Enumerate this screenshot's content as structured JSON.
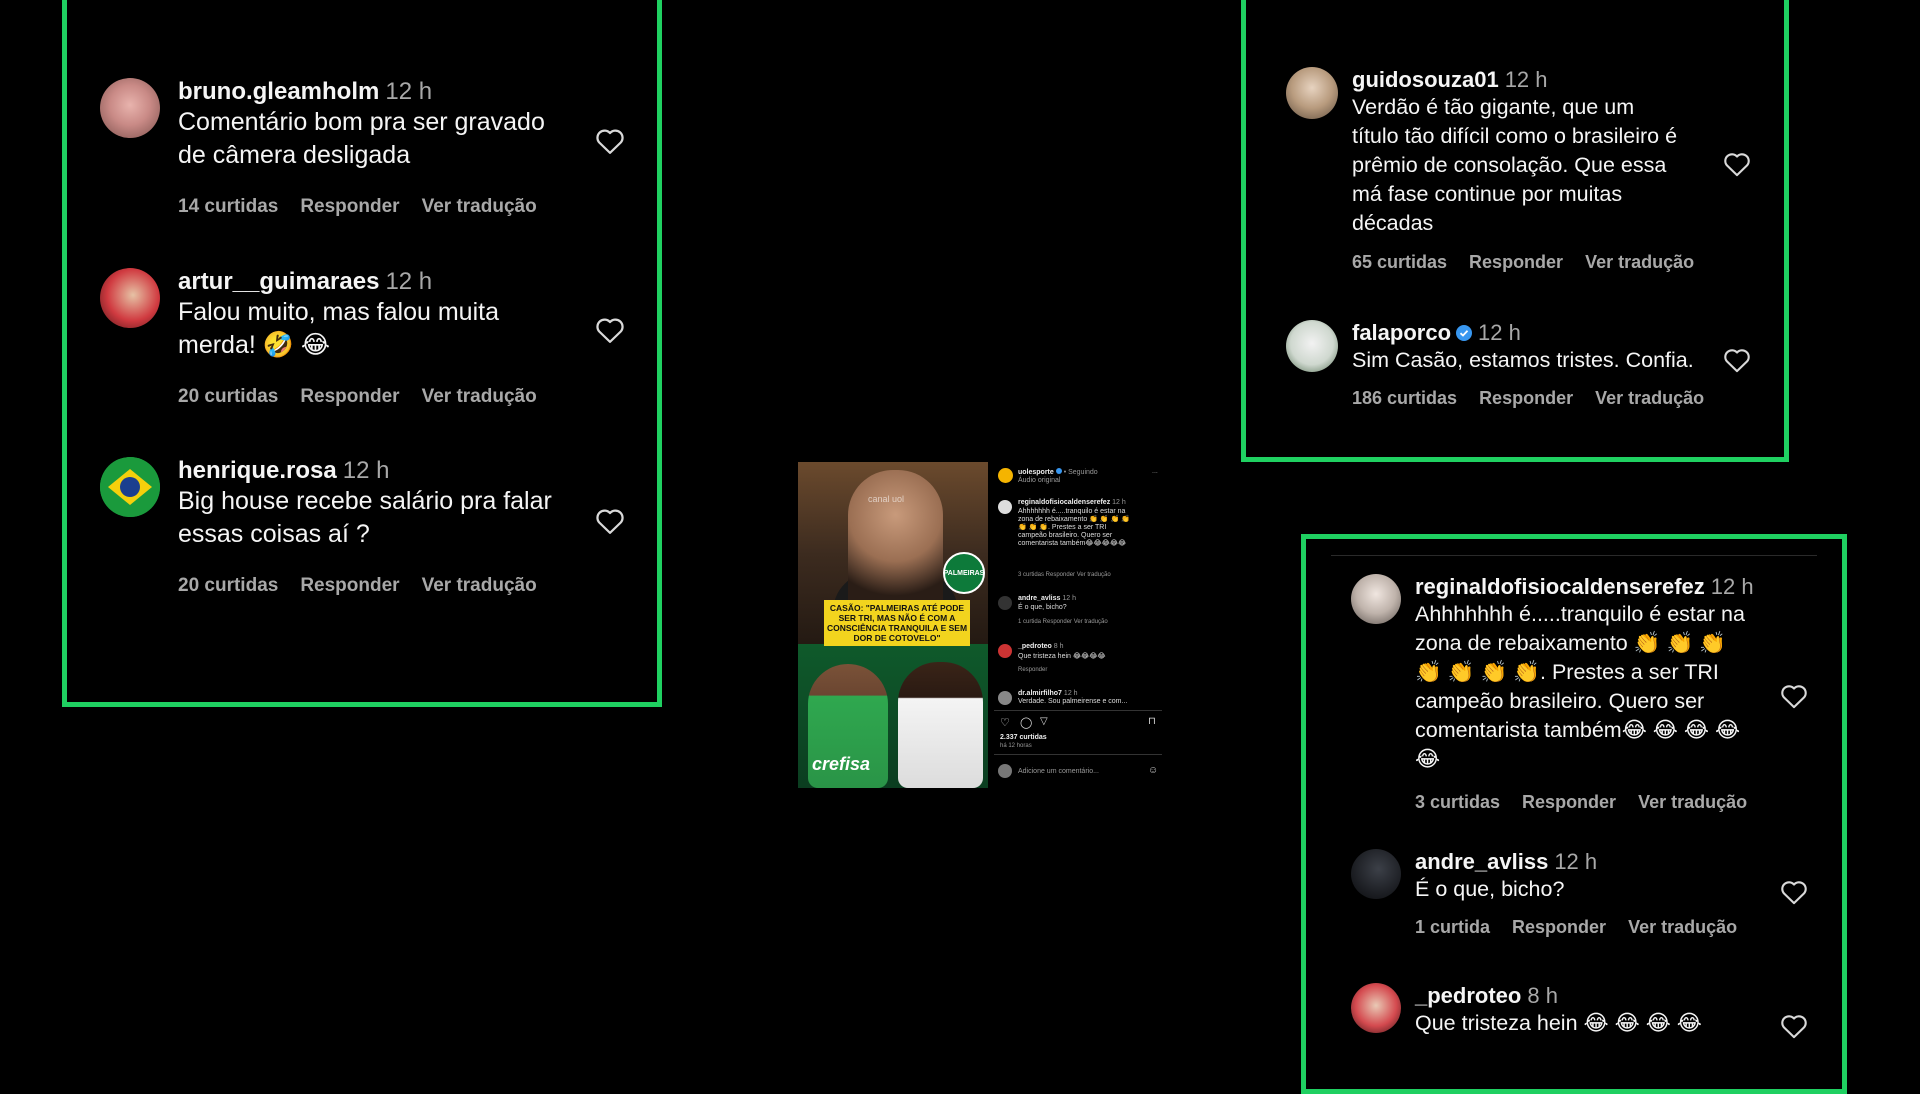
{
  "colors": {
    "frame": "#1fd061",
    "text": "#f5f5f5",
    "muted": "#a8a8a8",
    "verified": "#3897f0"
  },
  "left_panel": {
    "comments": [
      {
        "username": "bruno.gleamholm",
        "time": "12 h",
        "text": "Comentário bom pra ser gravado\nde câmera desligada",
        "likes": "14 curtidas",
        "reply": "Responder",
        "translate": "Ver tradução",
        "icon": "heart-outline-icon"
      },
      {
        "username": "artur__guimaraes",
        "time": "12 h",
        "text": "Falou muito, mas falou muita\nmerda! 🤣 😂",
        "likes": "20 curtidas",
        "reply": "Responder",
        "translate": "Ver tradução",
        "icon": "heart-outline-icon"
      },
      {
        "username": "henrique.rosa",
        "time": "12 h",
        "text": "Big house recebe salário pra falar\nessas coisas aí ?",
        "likes": "20 curtidas",
        "reply": "Responder",
        "translate": "Ver tradução",
        "icon": "heart-outline-icon"
      }
    ]
  },
  "top_right_panel": {
    "comments": [
      {
        "username": "guidosouza01",
        "time": "12 h",
        "text": "Verdão é tão gigante, que um\ntítulo tão difícil como o brasileiro é\nprêmio de consolação. Que essa\nmá fase continue por muitas\ndécadas",
        "likes": "65 curtidas",
        "reply": "Responder",
        "translate": "Ver tradução"
      },
      {
        "username": "falaporco",
        "verified": true,
        "time": "12 h",
        "text": "Sim Casão, estamos tristes. Confia.",
        "likes": "186 curtidas",
        "reply": "Responder",
        "translate": "Ver tradução"
      }
    ]
  },
  "bottom_right_panel": {
    "comments": [
      {
        "username": "reginaldofisiocaldenserefez",
        "time": "12 h",
        "text": "Ahhhhhhh é.....tranquilo é estar na\nzona de rebaixamento 👏 👏 👏\n👏 👏 👏 👏. Prestes a ser TRI\ncampeão brasileiro. Quero ser\ncomentarista também😂 😂 😂 😂\n😂",
        "likes": "3 curtidas",
        "reply": "Responder",
        "translate": "Ver tradução"
      },
      {
        "username": "andre_avliss",
        "time": "12 h",
        "text": "É o que, bicho?",
        "likes": "1 curtida",
        "reply": "Responder",
        "translate": "Ver tradução"
      },
      {
        "username": "_pedroteo",
        "time": "8 h",
        "text": "Que tristeza hein 😂 😂 😂 😂",
        "likes": "",
        "reply": "",
        "translate": ""
      }
    ]
  },
  "center_post": {
    "account": "uolesporte",
    "following": "• Seguindo",
    "audio": "Áudio original",
    "more": "...",
    "watermark": "canal uol",
    "video_caption": "CASÃO: \"PALMEIRAS ATÉ PODE SER TRI, MAS NÃO É COM A CONSCIÊNCIA TRANQUILA E SEM DOR DE COTOVELO\"",
    "badge": "PALMEIRAS",
    "sponsor": "crefisa",
    "mini_comments": [
      {
        "user": "reginaldofisiocaldenserefez",
        "time": "12 h",
        "text": "Ahhhhhhh é.....tranquilo é estar na zona de rebaixamento 👏 👏 👏 👏 👏 👏 👏. Prestes a ser TRI campeão brasileiro. Quero ser comentarista também😂😂😂😂😂",
        "meta": "3 curtidas   Responder   Ver tradução"
      },
      {
        "user": "andre_avliss",
        "time": "12 h",
        "text": "É o que, bicho?",
        "meta": "1 curtida   Responder   Ver tradução"
      },
      {
        "user": "_pedroteo",
        "time": "8 h",
        "text": "Que tristeza hein 😂😂😂😂",
        "meta": "Responder"
      },
      {
        "user": "dr.almirfilho7",
        "time": "12 h",
        "text": "Verdade. Sou palmeirense e com...",
        "meta": ""
      }
    ],
    "likes": "2.337 curtidas",
    "posted": "há 12 horas",
    "add_comment_placeholder": "Adicione um comentário..."
  }
}
